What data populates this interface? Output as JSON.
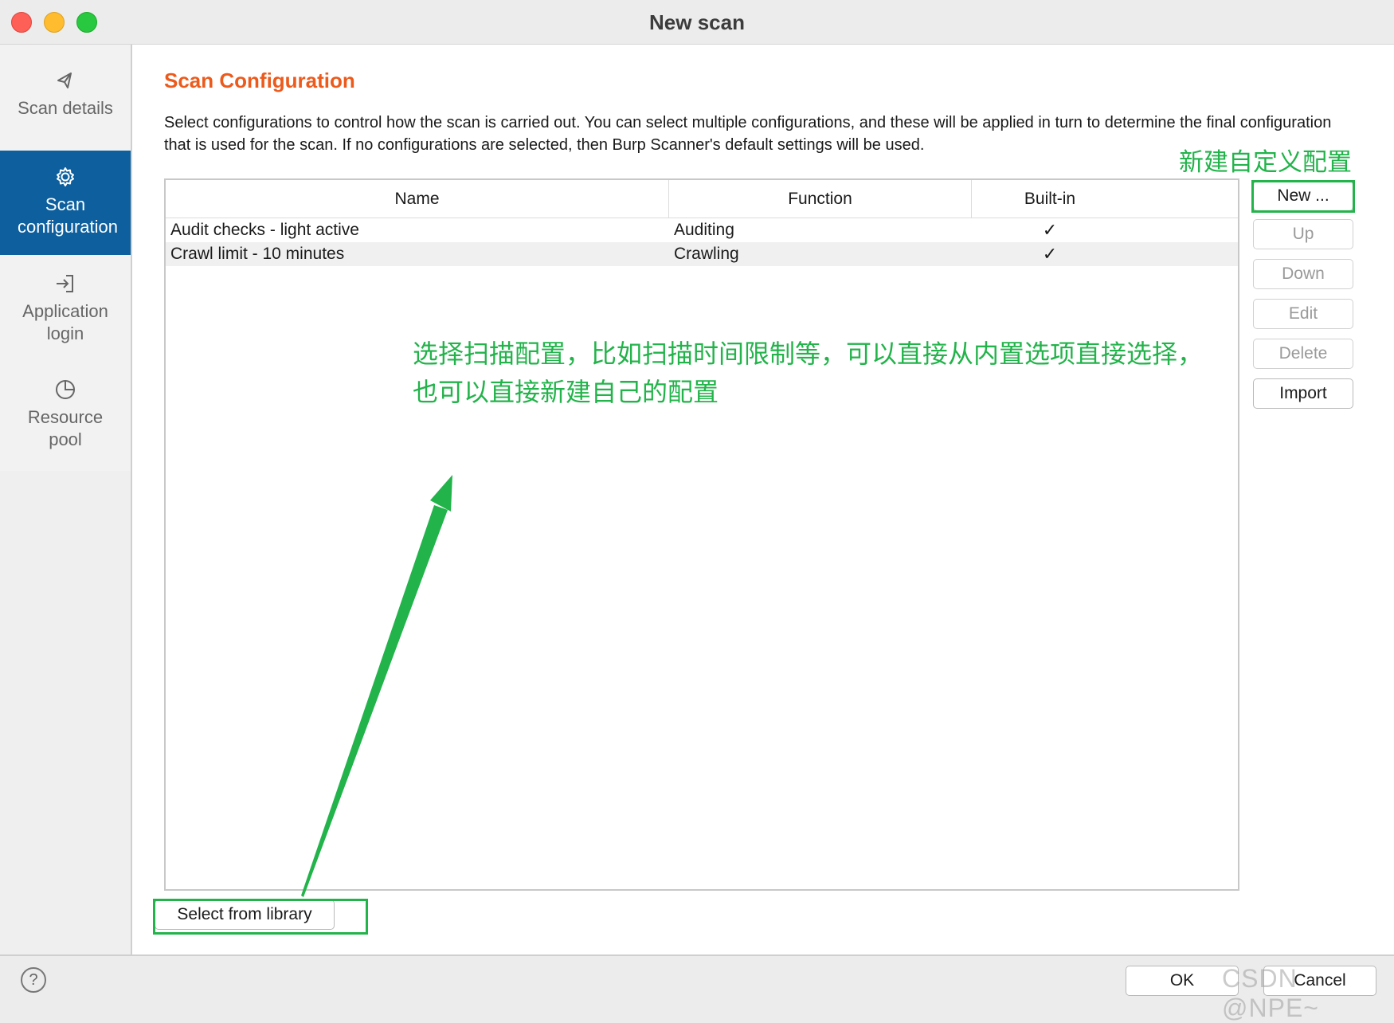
{
  "window": {
    "title": "New scan"
  },
  "sidebar": {
    "items": [
      {
        "label": "Scan details",
        "icon": "scan-details-icon"
      },
      {
        "label": "Scan configuration",
        "icon": "gear-icon",
        "active": true
      },
      {
        "label": "Application login",
        "icon": "login-icon"
      },
      {
        "label": "Resource pool",
        "icon": "pie-chart-icon"
      }
    ]
  },
  "main": {
    "heading": "Scan Configuration",
    "description": "Select configurations to control how the scan is carried out. You can select multiple configurations, and these will be applied in turn to determine the final configuration that is used for the scan. If no configurations are selected, then Burp Scanner's default settings will be used.",
    "table": {
      "headers": [
        "Name",
        "Function",
        "Built-in"
      ],
      "rows": [
        {
          "name": "Audit checks - light active",
          "function": "Auditing",
          "builtin": "✓"
        },
        {
          "name": "Crawl limit - 10 minutes",
          "function": "Crawling",
          "builtin": "✓"
        }
      ]
    },
    "buttons": {
      "new": "New ...",
      "up": "Up",
      "down": "Down",
      "edit": "Edit",
      "delete": "Delete",
      "import": "Import",
      "select_library": "Select from library"
    }
  },
  "annotations": {
    "new_note": "新建自定义配置",
    "main_note_line1": "选择扫描配置，比如扫描时间限制等，可以直接从内置选项直接选择，",
    "main_note_line2": "也可以直接新建自己的配置"
  },
  "footer": {
    "help": "?",
    "ok": "OK",
    "cancel": "Cancel",
    "watermark": "CSDN @NPE~"
  },
  "colors": {
    "accent": "#ec5a1c",
    "active_sidebar": "#0e5f9e",
    "annotation": "#22b34a"
  }
}
